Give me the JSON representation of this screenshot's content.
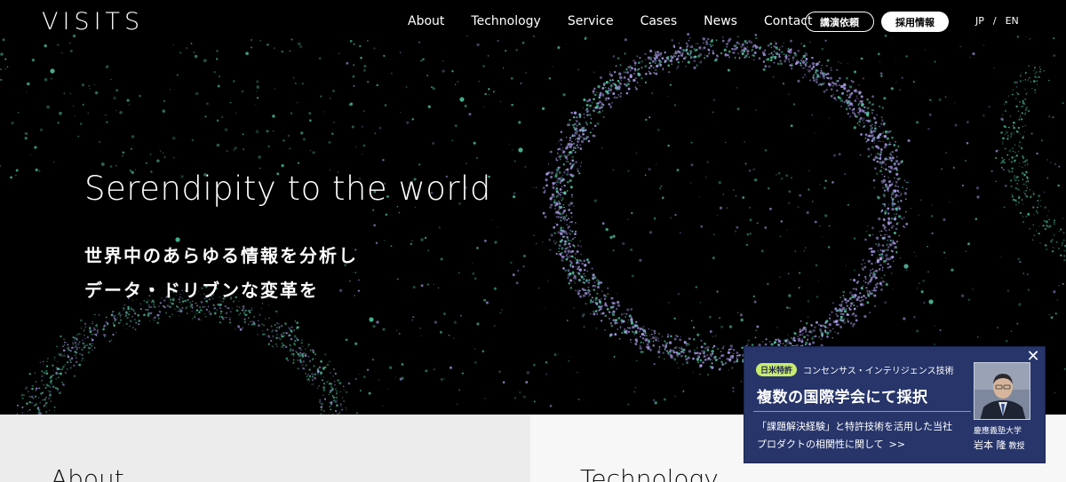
{
  "header": {
    "logo": "VISITS",
    "nav": [
      "About",
      "Technology",
      "Service",
      "Cases",
      "News",
      "Contact"
    ],
    "btn_lecture": "講演依頼",
    "btn_recruit": "採用情報",
    "lang_jp": "JP",
    "lang_sep": "/",
    "lang_en": "EN"
  },
  "hero": {
    "title": "Serendipity to the world",
    "subtitle_line1": "世界中のあらゆる情報を分析し",
    "subtitle_line2": "データ・ドリブンな変革を"
  },
  "sections": {
    "left_heading": "About",
    "right_heading": "Technology"
  },
  "popup": {
    "close": "✕",
    "badge": "日米特許",
    "tag": "コンセンサス・インテリジェンス技術",
    "title": "複数の国際学会にて採択",
    "desc_line1": "「課題解決経験」と特許技術を活用した当社",
    "desc_line2": "プロダクトの相関性に関して",
    "arrow": ">>",
    "affiliation": "慶應義塾大学",
    "name": "岩本 隆",
    "role": "教授"
  },
  "colors": {
    "hero_bg": "#000000",
    "particle_teal": "#52c9a4",
    "particle_violet": "#a99ae8",
    "popup_bg": "#27356a",
    "badge_bg": "#c8ec6f",
    "panel_left_bg": "#ececec",
    "panel_right_bg": "#f7f7f7"
  }
}
